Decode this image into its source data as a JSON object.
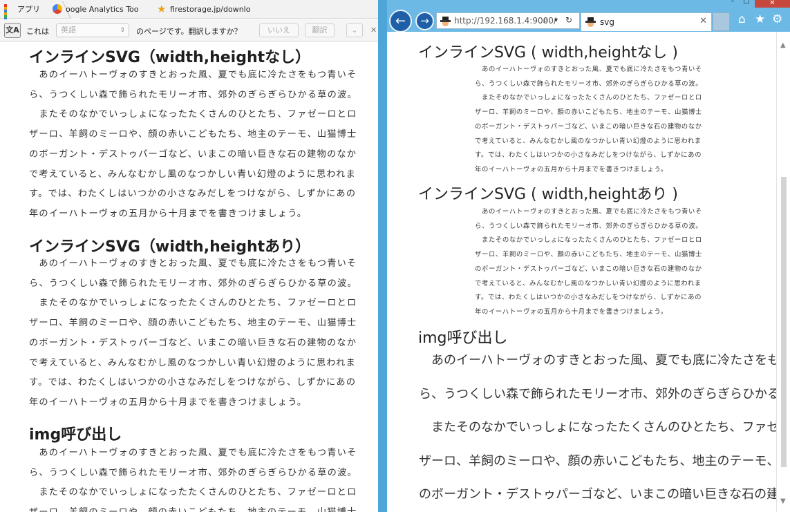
{
  "chrome": {
    "bookmarks": [
      {
        "label": "アプリ",
        "icon": "apps-grid-icon"
      },
      {
        "label": "oogle Analytics Too",
        "icon": "google-analytics-icon"
      },
      {
        "label": "firestorage.jp/downlo",
        "icon": "star-icon"
      }
    ],
    "translate_bar": {
      "icon_text": "文A",
      "prefix": "これは",
      "language": "英語",
      "suffix": "のページです。翻訳しますか？",
      "no_button": "いいえ",
      "translate_button": "翻訳",
      "options_arrow": "⌄",
      "close": "✕"
    },
    "page": {
      "heading1": "インラインSVG（width,heightなし）",
      "heading2": "インラインSVG（width,heightあり）",
      "heading3": "img呼び出し",
      "lines": [
        "　あのイーハトーヴォのすきとおった風、夏でも底に冷たさをもつ青いそ",
        "ら、うつくしい森で飾られたモリーオ市、郊外のぎらぎらひかる草の波。",
        "　またそのなかでいっしょになったたくさんのひとたち、ファゼーロとロ",
        "ザーロ、羊飼のミーロや、顔の赤いこどもたち、地主のテーモ、山猫博士",
        "のボーガント・デストゥパーゴなど、いまこの暗い巨きな石の建物のなか",
        "で考えていると、みんなむかし風のなつかしい青い幻燈のように思われま",
        "す。では、わたくしはいつかの小さなみだしをつけながら、しずかにあの",
        "年のイーハトーヴォの五月から十月までを書きつけましょう。"
      ]
    }
  },
  "ie": {
    "window_controls": {
      "minimize": "–",
      "maximize": "□",
      "close": "✕"
    },
    "back": "←",
    "forward": "→",
    "address": "http://192.168.1.4:9000/",
    "search_icon": "⌕",
    "dropdown_icon": "▾",
    "refresh_icon": "↻",
    "tab_title": "svg",
    "tab_close": "✕",
    "home": "⌂",
    "favorites": "★",
    "settings": "⚙",
    "page": {
      "heading1": "インラインSVG ( width,heightなし )",
      "heading2": "インラインSVG ( width,heightあり )",
      "heading3": "img呼び出し",
      "lines": [
        "　あのイーハトーヴォのすきとおった風、夏でも底に冷たさをもつ青いそ",
        "ら、うつくしい森で飾られたモリーオ市、郊外のぎらぎらひかる草の波。",
        "　またそのなかでいっしょになったたくさんのひとたち、ファゼーロとロ",
        "ザーロ、羊飼のミーロや、顔の赤いこどもたち、地主のテーモ、山猫博士",
        "のボーガント・デストゥパーゴなど、いまこの暗い巨きな石の建物のなか",
        "で考えていると、みんなむかし風のなつかしい青い幻燈のように思われま",
        "す。では、わたくしはいつかの小さなみだしをつけながら、しずかにあの",
        "年のイーハトーヴォの五月から十月までを書きつけましょう。"
      ]
    }
  },
  "colors": {
    "ie_frame": "#6cb9e6",
    "ie_nav": "#1f5fa8",
    "ie_close": "#c7483c"
  }
}
